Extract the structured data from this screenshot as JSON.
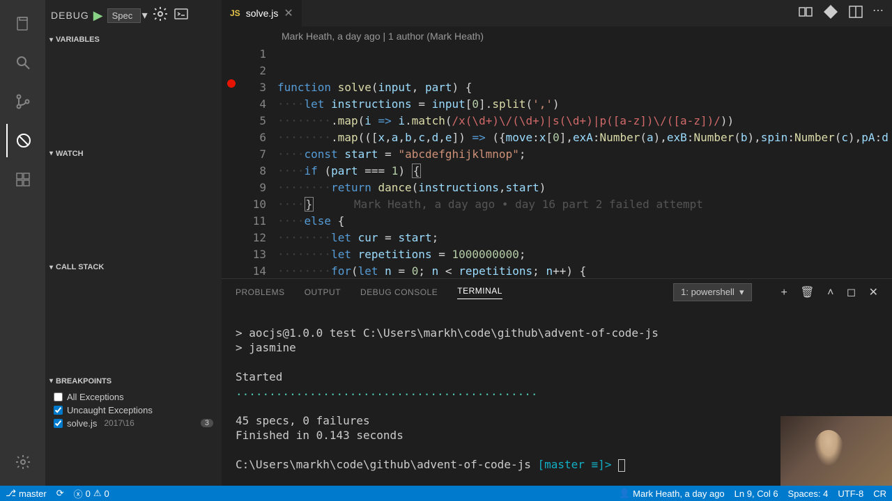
{
  "activity": {
    "active": "debug"
  },
  "debug": {
    "title": "DEBUG",
    "config": "Spec",
    "panels": {
      "variables": "VARIABLES",
      "watch": "WATCH",
      "callstack": "CALL STACK",
      "breakpoints": "BREAKPOINTS"
    },
    "breakpoints": {
      "all_exceptions": "All Exceptions",
      "uncaught": "Uncaught Exceptions",
      "file": "solve.js",
      "file_path": "2017\\16",
      "badge": "3"
    }
  },
  "tab": {
    "icon": "JS",
    "name": "solve.js"
  },
  "codelens": "Mark Heath, a day ago | 1 author (Mark Heath)",
  "code": {
    "lines": [
      1,
      2,
      3,
      4,
      5,
      6,
      7,
      8,
      9,
      10,
      11,
      12,
      13,
      14
    ],
    "breakpoint_line": 3,
    "blame": "Mark Heath, a day ago • day 16 part 2 failed attempt"
  },
  "panel": {
    "tabs": {
      "problems": "PROBLEMS",
      "output": "OUTPUT",
      "debug_console": "DEBUG CONSOLE",
      "terminal": "TERMINAL"
    },
    "term_select": "1: powershell"
  },
  "terminal": {
    "line1_prefix": ">",
    "line1": "aocjs@1.0.0 test C:\\Users\\markh\\code\\github\\advent-of-code-js",
    "line2": "jasmine",
    "started": "Started",
    "dots": ".............................................",
    "result1": "45 specs, 0 failures",
    "result2": "Finished in 0.143 seconds",
    "prompt_path": "C:\\Users\\markh\\code\\github\\advent-of-code-js",
    "prompt_branch": "[master ≡]>"
  },
  "status": {
    "branch": "master",
    "errors": "0",
    "warnings": "0",
    "blame": "Mark Heath, a day ago",
    "position": "Ln 9, Col 6",
    "spaces": "Spaces: 4",
    "encoding": "UTF-8",
    "eol": "CR"
  }
}
